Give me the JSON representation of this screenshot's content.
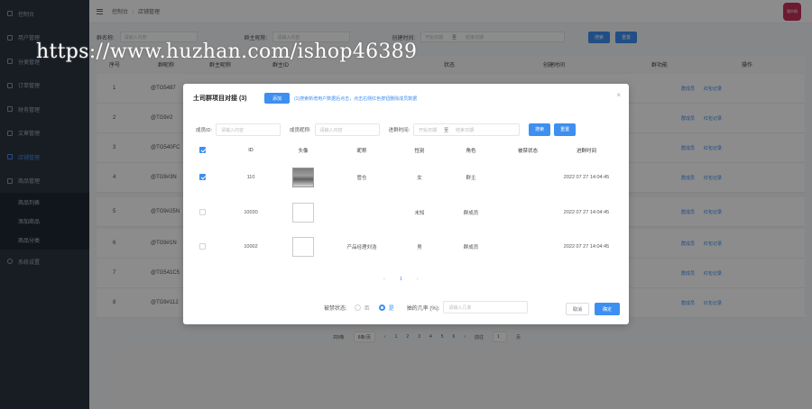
{
  "sidebar": {
    "items": [
      {
        "label": "控制台"
      },
      {
        "label": "用户管理"
      },
      {
        "label": "分类管理"
      },
      {
        "label": "订单管理"
      },
      {
        "label": "财务管理"
      },
      {
        "label": "文章管理"
      },
      {
        "label": "店铺管理"
      },
      {
        "label": "商品管理"
      }
    ],
    "sub_items": [
      {
        "label": "商品列表"
      },
      {
        "label": "添加商品"
      },
      {
        "label": "商品分类"
      }
    ],
    "last": {
      "label": "系统设置"
    }
  },
  "topbar": {
    "breadcrumb_home": "控制台",
    "breadcrumb_sep": "/",
    "breadcrumb_current": "店铺管理",
    "avatar_text": "银尔网"
  },
  "filters": {
    "name_label": "群名称:",
    "name_placeholder": "请输入内容",
    "owner_label": "群主昵称:",
    "owner_placeholder": "请输入内容",
    "time_label": "创建时间:",
    "start_placeholder": "开始日期",
    "end_placeholder": "结束日期",
    "sep": "至",
    "search_btn": "搜索",
    "reset_btn": "重置"
  },
  "table": {
    "headers": [
      "序号",
      "群昵称",
      "群主昵称",
      "群主ID",
      "",
      "状态",
      "创建时间",
      "群功能",
      "操作"
    ],
    "rows": [
      {
        "index": "1",
        "code": "@TG5487"
      },
      {
        "index": "2",
        "code": "@TG9#2"
      },
      {
        "index": "3",
        "code": "@TG540FC"
      },
      {
        "index": "4",
        "code": "@TG9#3N"
      },
      {
        "index": "5",
        "code": "@TG9#25N"
      },
      {
        "index": "6",
        "code": "@TG9#1N"
      },
      {
        "index": "7",
        "code": "@TG541C5"
      },
      {
        "index": "8",
        "code": "@TG9#112"
      }
    ],
    "actions": [
      "群成员",
      "设置管理",
      "红包记录"
    ]
  },
  "pager": {
    "total": "共8条",
    "per_page": "8条/页",
    "pages": [
      "1",
      "2",
      "3",
      "4",
      "5",
      "6"
    ],
    "goto": "前往",
    "page_input": "1",
    "unit": "页"
  },
  "watermark": "https://www.huzhan.com/ishop46389",
  "modal": {
    "title": "土司群项目对接 (3)",
    "add_btn": "添加",
    "tip": "(1)搜索新增用户数据后点击，点击右侧红色按钮删除成员数据",
    "close": "×",
    "filters": {
      "uid_label": "成员ID:",
      "uid_placeholder": "请输入内容",
      "nick_label": "成员昵称:",
      "nick_placeholder": "请输入内容",
      "time_label": "进群时间:",
      "start_placeholder": "开始日期",
      "end_placeholder": "结束日期",
      "sep": "至",
      "search_btn": "搜索",
      "reset_btn": "重置"
    },
    "headers": [
      "",
      "ID",
      "头像",
      "昵称",
      "性别",
      "角色",
      "被禁状态",
      "进群时间"
    ],
    "rows": [
      {
        "id": "110",
        "nick": "管仓",
        "gender": "女",
        "role": "群主",
        "ban": "",
        "time": "2022 07 27 14:04:45",
        "checked": true,
        "photo": true
      },
      {
        "id": "10030",
        "nick": "",
        "gender": "未知",
        "role": "群成员",
        "ban": "",
        "time": "2022 07 27 14:04:45",
        "checked": false,
        "photo": false
      },
      {
        "id": "10002",
        "nick": "产品经理刘浩",
        "gender": "男",
        "role": "群成员",
        "ban": "",
        "time": "2022 07 27 14:04:45",
        "checked": false,
        "photo": false
      }
    ],
    "pager": {
      "prev": "‹",
      "page": "1",
      "next": "›"
    },
    "footer": {
      "ban_label": "被禁状态:",
      "opt_no": "否",
      "opt_yes": "是",
      "rate_label": "抽的几率 (%):",
      "rate_placeholder": "请输入几率",
      "cancel_btn": "取消",
      "confirm_btn": "确定"
    }
  }
}
